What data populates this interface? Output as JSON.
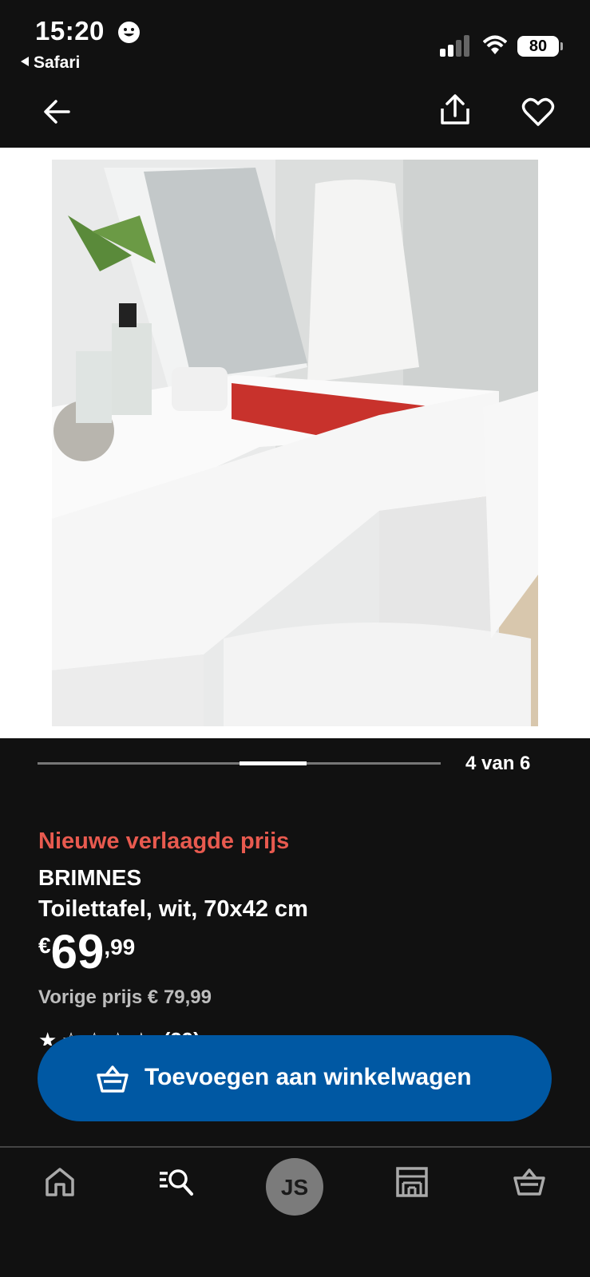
{
  "status_bar": {
    "time": "15:20",
    "back_app": "Safari",
    "battery": "80"
  },
  "pager": {
    "text": "4 van 6",
    "current": 4,
    "total": 6
  },
  "product": {
    "promo": "Nieuwe verlaagde prijs",
    "name": "BRIMNES",
    "description": "Toilettafel, wit, 70x42 cm",
    "price_currency": "€",
    "price_int": "69",
    "price_dec": ",99",
    "previous_price": "Vorige prijs € 79,99",
    "rating_count": "(29)"
  },
  "cart_button": {
    "label": "Toevoegen aan winkelwagen"
  },
  "tab_bar": {
    "profile_initials": "JS"
  },
  "colors": {
    "background": "#111111",
    "promo": "#e85a4f",
    "cta": "#0058a3"
  },
  "icons": [
    "arrow-back-icon",
    "share-icon",
    "heart-icon",
    "basket-icon",
    "home-icon",
    "search-list-icon",
    "store-icon",
    "cart-icon"
  ]
}
